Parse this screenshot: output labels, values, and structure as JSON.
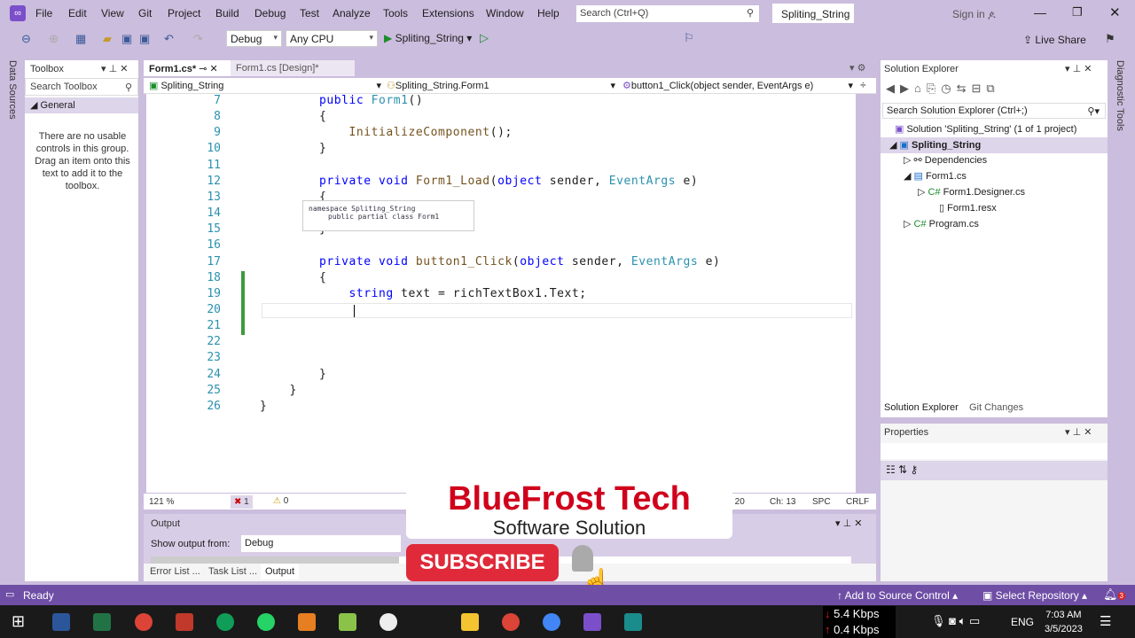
{
  "menu": [
    "File",
    "Edit",
    "View",
    "Git",
    "Project",
    "Build",
    "Debug",
    "Test",
    "Analyze",
    "Tools",
    "Extensions",
    "Window",
    "Help"
  ],
  "search": {
    "placeholder": "Search (Ctrl+Q)"
  },
  "project_title": "Spliting_String",
  "sign_in": "Sign in",
  "toolbar": {
    "config": "Debug",
    "platform": "Any CPU",
    "start_target": "Spliting_String",
    "live_share": "Live Share"
  },
  "left_rail": "Data Sources",
  "right_rail": "Diagnostic Tools",
  "toolbox": {
    "title": "Toolbox",
    "search_placeholder": "Search Toolbox",
    "group": "General",
    "empty_text": "There are no usable controls in this group. Drag an item onto this text to add it to the toolbox."
  },
  "editor": {
    "tabs": [
      {
        "label": "Form1.cs*"
      },
      {
        "label": "Form1.cs [Design]*"
      }
    ],
    "nav": {
      "project": "Spliting_String",
      "class": "Spliting_String.Form1",
      "member": "button1_Click(object sender, EventArgs e)"
    },
    "lines": [
      {
        "n": "7",
        "t": [
          [
            "        ",
            "pl"
          ],
          [
            "public ",
            "kw"
          ],
          [
            "Form1",
            "ty"
          ],
          [
            "()",
            "pl"
          ]
        ]
      },
      {
        "n": "8",
        "t": [
          [
            "        {",
            "pl"
          ]
        ]
      },
      {
        "n": "9",
        "t": [
          [
            "            ",
            "pl"
          ],
          [
            "InitializeComponent",
            "fn"
          ],
          [
            "();",
            "pl"
          ]
        ]
      },
      {
        "n": "10",
        "t": [
          [
            "        }",
            "pl"
          ]
        ]
      },
      {
        "n": "11",
        "t": []
      },
      {
        "n": "12",
        "t": [
          [
            "        ",
            "pl"
          ],
          [
            "private void ",
            "kw"
          ],
          [
            "Form1_Load",
            "fn"
          ],
          [
            "(",
            "pl"
          ],
          [
            "object ",
            "kw"
          ],
          [
            "sender, ",
            "pl"
          ],
          [
            "EventArgs ",
            "ty"
          ],
          [
            "e)",
            "pl"
          ]
        ]
      },
      {
        "n": "13",
        "t": [
          [
            "        {",
            "pl"
          ]
        ]
      },
      {
        "n": "14",
        "t": []
      },
      {
        "n": "15",
        "t": [
          [
            "        }",
            "pl"
          ]
        ]
      },
      {
        "n": "16",
        "t": []
      },
      {
        "n": "17",
        "t": [
          [
            "        ",
            "pl"
          ],
          [
            "private void ",
            "kw"
          ],
          [
            "button1_Click",
            "fn"
          ],
          [
            "(",
            "pl"
          ],
          [
            "object ",
            "kw"
          ],
          [
            "sender, ",
            "pl"
          ],
          [
            "EventArgs ",
            "ty"
          ],
          [
            "e)",
            "pl"
          ]
        ]
      },
      {
        "n": "18",
        "t": [
          [
            "        {",
            "pl"
          ]
        ]
      },
      {
        "n": "19",
        "t": [
          [
            "            ",
            "pl"
          ],
          [
            "string ",
            "kw"
          ],
          [
            "text = richTextBox1.Text;",
            "pl"
          ]
        ]
      },
      {
        "n": "20",
        "t": []
      },
      {
        "n": "21",
        "t": []
      },
      {
        "n": "22",
        "t": []
      },
      {
        "n": "23",
        "t": []
      },
      {
        "n": "24",
        "t": [
          [
            "        }",
            "pl"
          ]
        ]
      },
      {
        "n": "25",
        "t": [
          [
            "    }",
            "pl"
          ]
        ]
      },
      {
        "n": "26",
        "t": [
          [
            "}",
            "pl"
          ]
        ]
      }
    ],
    "tooltip": {
      "line1": "namespace Spliting_String",
      "line2": "public partial class Form1"
    },
    "zoom": "121 %",
    "errors": "1",
    "warnings": "0",
    "position": {
      "ln": "Ln: 20",
      "ch": "Ch: 13",
      "spc": "SPC",
      "eol": "CRLF"
    }
  },
  "output": {
    "title": "Output",
    "show_from_label": "Show output from:",
    "source": "Debug",
    "tabs": [
      "Error List ...",
      "Task List ...",
      "Output"
    ]
  },
  "solution_explorer": {
    "title": "Solution Explorer",
    "search_placeholder": "Search Solution Explorer (Ctrl+;)",
    "tree": [
      {
        "label": "Solution 'Spliting_String' (1 of 1 project)"
      },
      {
        "label": "Spliting_String"
      },
      {
        "label": "Dependencies"
      },
      {
        "label": "Form1.cs"
      },
      {
        "label": "Form1.Designer.cs"
      },
      {
        "label": "Form1.resx"
      },
      {
        "label": "Program.cs"
      }
    ],
    "tabs": [
      "Solution Explorer",
      "Git Changes"
    ]
  },
  "properties": {
    "title": "Properties"
  },
  "status": {
    "ready": "Ready",
    "add_source": "Add to Source Control",
    "select_repo": "Select Repository",
    "notifications": "3"
  },
  "overlay": {
    "brand": "BlueFrost Tech",
    "tagline": "Software Solution",
    "subscribe": "SUBSCRIBE"
  },
  "taskbar": {
    "down": "5.4 Kbps",
    "up": "0.4 Kbps",
    "lang": "ENG",
    "time": "7:03 AM",
    "date": "3/5/2023"
  },
  "colors": {
    "accent": "#6f4ea6",
    "chrome": "#cbbddd",
    "brand_red": "#d0021b"
  }
}
